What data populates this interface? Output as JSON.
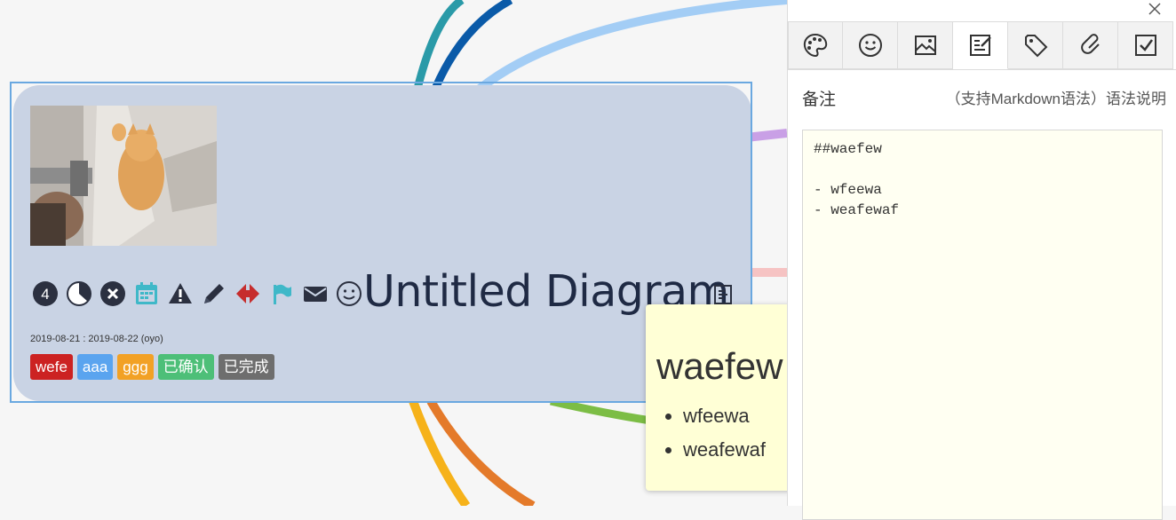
{
  "node": {
    "title": "Untitled Diagram",
    "dates": "2019-08-21 : 2019-08-22  (oyo)",
    "priority_number": "4",
    "tags": [
      {
        "label": "wefe",
        "color": "#c22"
      },
      {
        "label": "aaa",
        "color": "#5aa4ef"
      },
      {
        "label": "ggg",
        "color": "#f2a125"
      },
      {
        "label": "已确认",
        "color": "#4dbf78"
      },
      {
        "label": "已完成",
        "color": "#6e6e6e"
      }
    ],
    "icons": [
      "priority-4-icon",
      "progress-half-icon",
      "cancel-icon",
      "calendar-icon",
      "warning-icon",
      "pencil-icon",
      "arrows-icon",
      "flag-icon",
      "envelope-icon",
      "smiley-icon"
    ],
    "image": "kitten-with-gun-image"
  },
  "tooltip": {
    "heading": "waefew",
    "items": [
      "wfeewa",
      "weafewaf"
    ]
  },
  "panel": {
    "tabs": [
      "palette-icon",
      "emoji-icon",
      "image-icon",
      "note-icon",
      "tag-icon",
      "link-icon",
      "task-icon"
    ],
    "active_tab": "note-icon",
    "note_label": "备注",
    "note_help": "（支持Markdown语法）语法说明",
    "editor_lines": [
      "##waefew",
      "",
      "- wfeewa",
      "- weafewaf"
    ]
  },
  "colors": {
    "node_bg": "#c9d3e4",
    "selection": "#6aa8e0",
    "tooltip_bg": "#ffffd6",
    "editor_bg": "#fffff2"
  }
}
